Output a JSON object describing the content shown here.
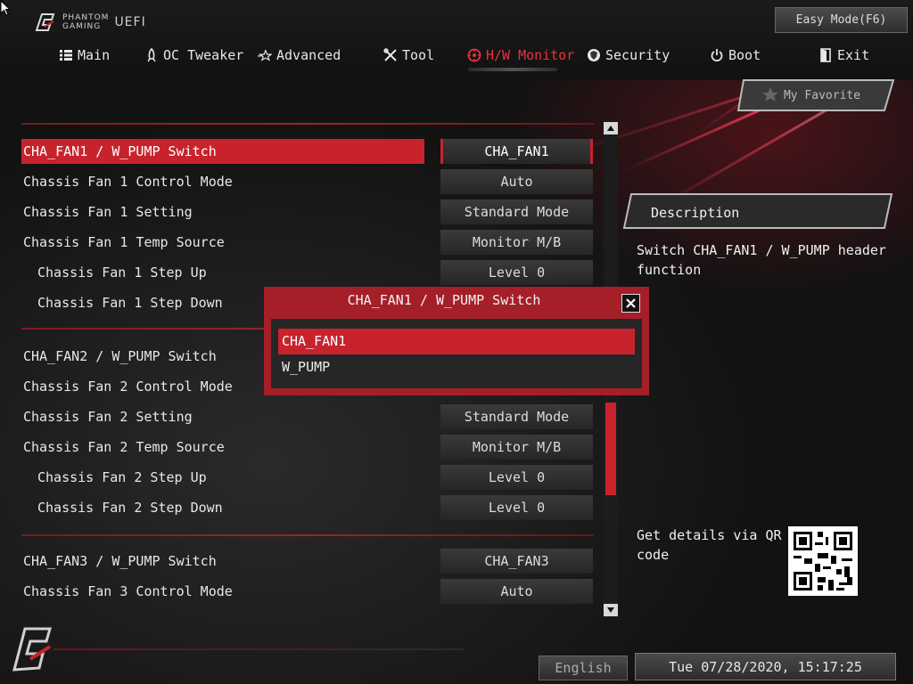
{
  "app": {
    "brand_line1": "PHANTOM",
    "brand_line2": "GAMING",
    "uefi": "UEFI",
    "easy_mode": "Easy Mode(F6)"
  },
  "nav": {
    "main": "Main",
    "oc_tweaker": "OC Tweaker",
    "advanced": "Advanced",
    "tool": "Tool",
    "hw_monitor": "H/W Monitor",
    "security": "Security",
    "boot": "Boot",
    "exit": "Exit"
  },
  "favorite": "My Favorite",
  "settings": [
    {
      "label": "CHA_FAN1 / W_PUMP Switch",
      "value": "CHA_FAN1"
    },
    {
      "label": "Chassis Fan 1 Control Mode",
      "value": "Auto"
    },
    {
      "label": "Chassis Fan 1 Setting",
      "value": "Standard Mode"
    },
    {
      "label": "Chassis Fan 1 Temp Source",
      "value": "Monitor M/B"
    },
    {
      "label": "Chassis Fan 1 Step Up",
      "value": "Level 0"
    },
    {
      "label": "Chassis Fan 1 Step Down",
      "value": ""
    },
    {
      "label": "CHA_FAN2 / W_PUMP Switch",
      "value": ""
    },
    {
      "label": "Chassis Fan 2 Control Mode",
      "value": ""
    },
    {
      "label": "Chassis Fan 2 Setting",
      "value": "Standard Mode"
    },
    {
      "label": "Chassis Fan 2 Temp Source",
      "value": "Monitor M/B"
    },
    {
      "label": "Chassis Fan 2 Step Up",
      "value": "Level 0"
    },
    {
      "label": "Chassis Fan 2 Step Down",
      "value": "Level 0"
    },
    {
      "label": "CHA_FAN3 / W_PUMP Switch",
      "value": "CHA_FAN3"
    },
    {
      "label": "Chassis Fan 3 Control Mode",
      "value": "Auto"
    }
  ],
  "dialog": {
    "title": "CHA_FAN1 / W_PUMP Switch",
    "options": [
      "CHA_FAN1",
      "W_PUMP"
    ],
    "selected_index": 0
  },
  "description": {
    "header": "Description",
    "text": "Switch CHA_FAN1 / W_PUMP header function",
    "qr_text": "Get details via QR code"
  },
  "footer": {
    "language": "English",
    "datetime": "Tue 07/28/2020, 15:17:25"
  },
  "colors": {
    "accent": "#c8232d",
    "active_tab": "#e8323f"
  }
}
